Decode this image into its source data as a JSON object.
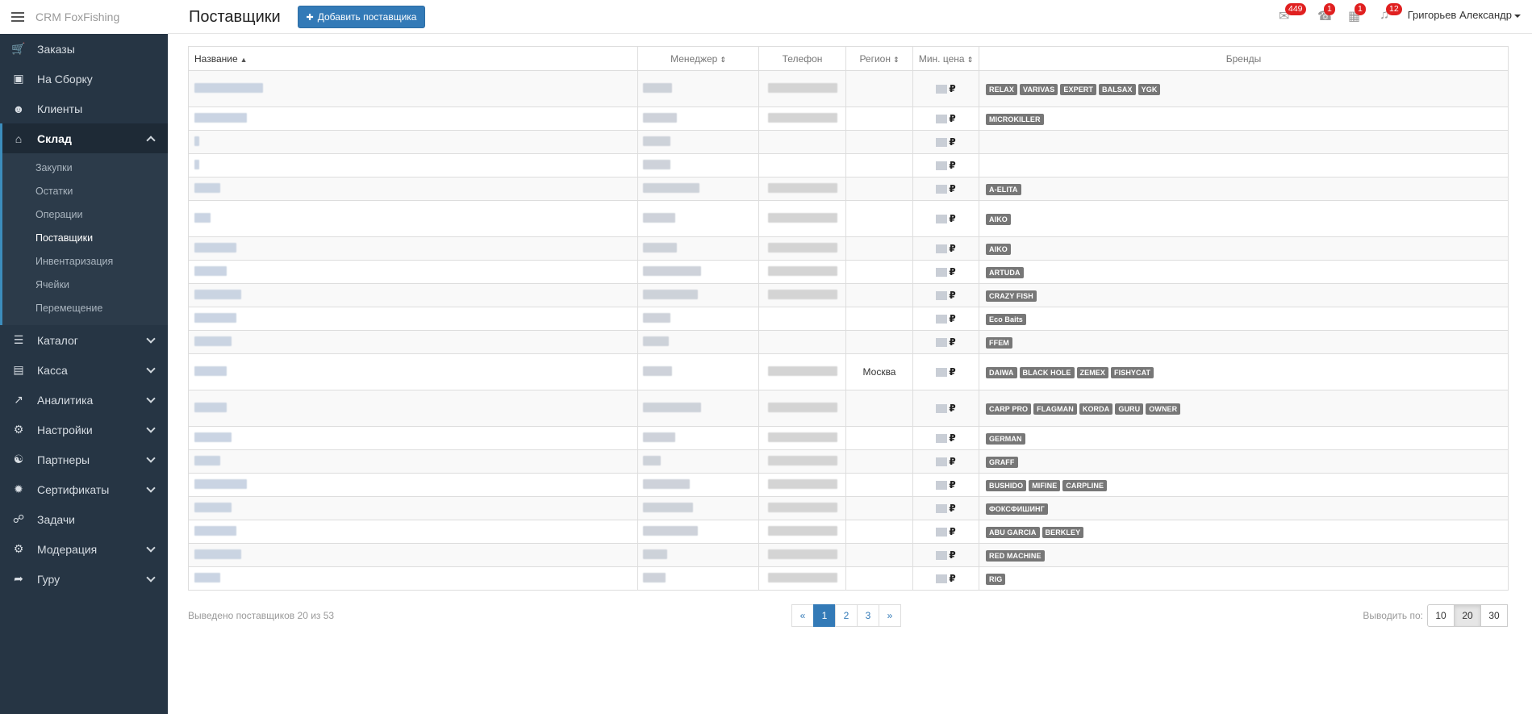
{
  "brand": {
    "title": "CRM FoxFishing"
  },
  "header": {
    "page_title": "Поставщики",
    "add_button": "Добавить поставщика",
    "badges": {
      "messages": "449",
      "calls": "1",
      "calendar": "1",
      "notifications": "12"
    },
    "user": "Григорьев Александр"
  },
  "sidebar": {
    "items": [
      {
        "label": "Заказы",
        "icon": "cart-icon"
      },
      {
        "label": "На Сборку",
        "icon": "inbox-icon"
      },
      {
        "label": "Клиенты",
        "icon": "users-icon"
      },
      {
        "label": "Склад",
        "icon": "home-icon"
      },
      {
        "label": "Каталог",
        "icon": "list-icon"
      },
      {
        "label": "Касса",
        "icon": "money-icon"
      },
      {
        "label": "Аналитика",
        "icon": "chart-icon"
      },
      {
        "label": "Настройки",
        "icon": "cogs-icon"
      },
      {
        "label": "Партнеры",
        "icon": "handshake-icon"
      },
      {
        "label": "Сертификаты",
        "icon": "certificate-icon"
      },
      {
        "label": "Задачи",
        "icon": "ticket-icon"
      },
      {
        "label": "Модерация",
        "icon": "cogs-icon"
      },
      {
        "label": "Гуру",
        "icon": "walk-icon"
      }
    ],
    "sklad_sub": [
      "Закупки",
      "Остатки",
      "Операции",
      "Поставщики",
      "Инвентаризация",
      "Ячейки",
      "Перемещение"
    ]
  },
  "table": {
    "headers": {
      "name": "Название",
      "manager": "Менеджер",
      "phone": "Телефон",
      "region": "Регион",
      "min_price": "Мин. цена",
      "brands": "Бренды"
    },
    "rows": [
      {
        "region": "",
        "brands": [
          "RELAX",
          "VARIVAS",
          "EXPERT",
          "BALSAX",
          "YGK"
        ]
      },
      {
        "region": "",
        "brands": [
          "MICROKILLER"
        ]
      },
      {
        "region": "",
        "brands": []
      },
      {
        "region": "",
        "brands": []
      },
      {
        "region": "",
        "brands": [
          "A-ELITA"
        ]
      },
      {
        "region": "",
        "brands": [
          "AIKO"
        ]
      },
      {
        "region": "",
        "brands": [
          "AIKO"
        ]
      },
      {
        "region": "",
        "brands": [
          "ARTUDA"
        ]
      },
      {
        "region": "",
        "brands": [
          "CRAZY FISH"
        ]
      },
      {
        "region": "",
        "brands": [
          "Eco Baits"
        ]
      },
      {
        "region": "",
        "brands": [
          "FFEM"
        ]
      },
      {
        "region": "Москва",
        "brands": [
          "DAIWA",
          "BLACK HOLE",
          "ZEMEX",
          "FISHYCAT"
        ]
      },
      {
        "region": "",
        "brands": [
          "CARP PRO",
          "FLAGMAN",
          "KORDA",
          "GURU",
          "OWNER"
        ]
      },
      {
        "region": "",
        "brands": [
          "GERMAN"
        ]
      },
      {
        "region": "",
        "brands": [
          "GRAFF"
        ]
      },
      {
        "region": "",
        "brands": [
          "BUSHIDO",
          "MIFINE",
          "CARPLINE"
        ]
      },
      {
        "region": "",
        "brands": [
          "ФОКСФИШИНГ"
        ]
      },
      {
        "region": "",
        "brands": [
          "ABU GARCIA",
          "BERKLEY"
        ]
      },
      {
        "region": "",
        "brands": [
          "RED MACHINE"
        ]
      },
      {
        "region": "",
        "brands": [
          "RIG"
        ]
      }
    ],
    "currency": "₽"
  },
  "footer": {
    "count_text": "Выведено поставщиков 20 из 53",
    "pages": [
      "«",
      "1",
      "2",
      "3",
      "»"
    ],
    "active_page": "1",
    "perpage_label": "Выводить по:",
    "perpage_options": [
      "10",
      "20",
      "30"
    ],
    "perpage_active": "20"
  }
}
